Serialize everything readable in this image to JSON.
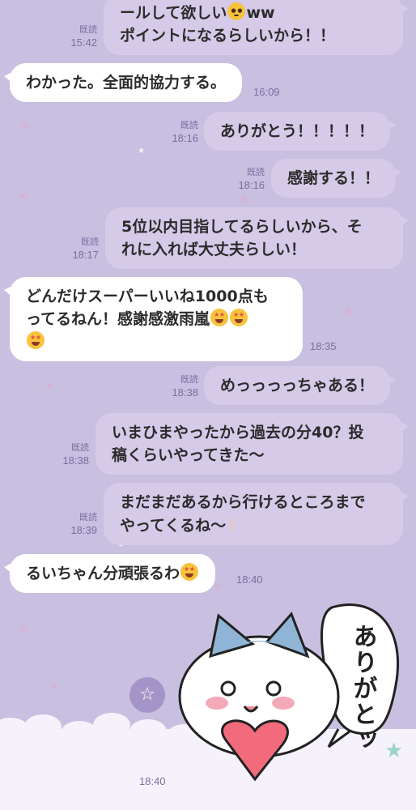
{
  "messages": [
    {
      "side": "out",
      "lines": [
        "ールして欲しい",
        "ポイントになるらしいから！！"
      ],
      "emoji_after_line1": "pleading-face-emoji",
      "tail_text": "ww",
      "read": "既読",
      "time": "15:42"
    },
    {
      "side": "in",
      "lines": [
        "わかった。全面的協力する。"
      ],
      "time": "16:09"
    },
    {
      "side": "out",
      "lines": [
        "ありがとう！！！！！"
      ],
      "read": "既読",
      "time": "18:16"
    },
    {
      "side": "out",
      "lines": [
        "感謝する！！"
      ],
      "read": "既読",
      "time": "18:16"
    },
    {
      "side": "out",
      "lines": [
        "5位以内目指してるらしいから、そ",
        "れに入れば大丈夫らしい！"
      ],
      "read": "既読",
      "time": "18:17"
    },
    {
      "side": "in",
      "lines": [
        "どんだけスーパーいいね1000点も",
        "ってるねん！感謝感激雨嵐"
      ],
      "emojis": "star-struck-emoji",
      "time": "18:35"
    },
    {
      "side": "out",
      "lines": [
        "めっっっっちゃある！"
      ],
      "read": "既読",
      "time": "18:38"
    },
    {
      "side": "out",
      "lines": [
        "いまひまやったから過去の分40？投",
        "稿くらいやってきた〜"
      ],
      "read": "既読",
      "time": "18:38"
    },
    {
      "side": "out",
      "lines": [
        "まだまだあるから行けるところまで",
        "やってくるね〜"
      ],
      "emoji_end": "victory-hand-emoji",
      "read": "既読",
      "time": "18:39"
    },
    {
      "side": "in",
      "lines": [
        "るいちゃん分頑張るわ"
      ],
      "emoji_end": "star-struck-emoji",
      "time": "18:40"
    }
  ],
  "sticker": {
    "speech_text": "ありがとッ",
    "time": "18:40"
  },
  "icons": {
    "floating_button": "star-icon",
    "emoji_plead": "pleading-face-emoji",
    "emoji_star": "star-struck-emoji",
    "emoji_peace": "victory-hand-emoji"
  },
  "glyphs": {
    "peace": "✌",
    "star": "☆"
  },
  "colors": {
    "background": "#c9bfe0",
    "outgoing_bubble": "#d5cae8",
    "incoming_bubble": "#ffffff",
    "meta_text": "#7c6ea0"
  }
}
